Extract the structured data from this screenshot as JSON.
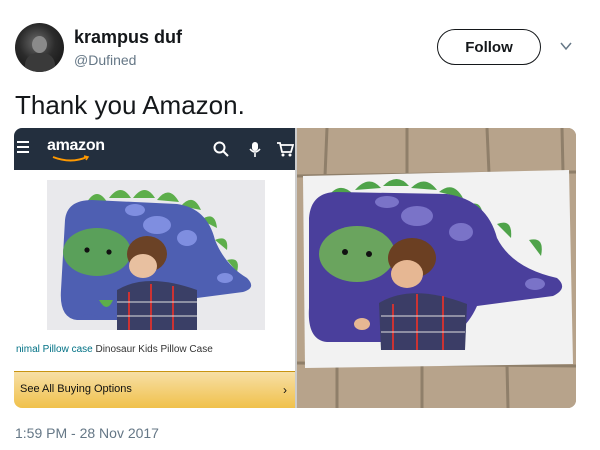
{
  "author": {
    "display_name": "krampus duf",
    "handle": "@Dufined",
    "avatar_icon": "user-avatar"
  },
  "follow_label": "Follow",
  "more_icon": "chevron-down-icon",
  "tweet_text": "Thank you Amazon.",
  "media": {
    "left": {
      "brand": "amazon",
      "icons": [
        "menu-icon",
        "search-icon",
        "microphone-icon",
        "cart-icon"
      ],
      "product_title_link": "nimal Pillow case",
      "product_title_rest": " Dinosaur Kids Pillow Case",
      "buy_label": "See All Buying Options",
      "buy_arrow": "›"
    },
    "right": {
      "description_icon": "photo-of-pillowcase"
    }
  },
  "timestamp": "1:59 PM - 28 Nov 2017",
  "colors": {
    "amazon_bar": "#232f3e",
    "buy_bar": "#f0c14b",
    "dino_body": "#4e5fb2",
    "dino_belly": "#5aa05a",
    "dino_spikes": "#5dae4b"
  }
}
